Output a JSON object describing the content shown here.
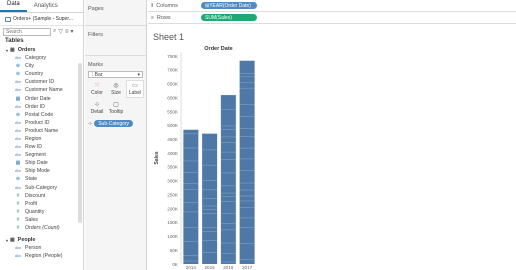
{
  "data_pane": {
    "tabs": [
      "Data",
      "Analytics"
    ],
    "datasource": "Orders+ (Sample - Super...",
    "search_placeholder": "Search",
    "tables_title": "Tables",
    "groups": [
      {
        "name": "Orders",
        "dimensions": [
          {
            "name": "Category",
            "icon": "abc"
          },
          {
            "name": "City",
            "icon": "globe"
          },
          {
            "name": "Country",
            "icon": "globe"
          },
          {
            "name": "Customer ID",
            "icon": "abc"
          },
          {
            "name": "Customer Name",
            "icon": "abc"
          },
          {
            "name": "Order Date",
            "icon": "date"
          },
          {
            "name": "Order ID",
            "icon": "abc"
          },
          {
            "name": "Postal Code",
            "icon": "globe"
          },
          {
            "name": "Product ID",
            "icon": "abc"
          },
          {
            "name": "Product Name",
            "icon": "abc"
          },
          {
            "name": "Region",
            "icon": "abc"
          },
          {
            "name": "Row ID",
            "icon": "abc"
          },
          {
            "name": "Segment",
            "icon": "abc"
          },
          {
            "name": "Ship Date",
            "icon": "date"
          },
          {
            "name": "Ship Mode",
            "icon": "abc"
          },
          {
            "name": "State",
            "icon": "globe"
          },
          {
            "name": "Sub-Category",
            "icon": "abc"
          }
        ],
        "measures": [
          {
            "name": "Discount",
            "icon": "hash"
          },
          {
            "name": "Profit",
            "icon": "hash"
          },
          {
            "name": "Quantity",
            "icon": "hash"
          },
          {
            "name": "Sales",
            "icon": "hash"
          },
          {
            "name": "Orders (Count)",
            "icon": "hash"
          }
        ]
      },
      {
        "name": "People",
        "dimensions": [
          {
            "name": "Person",
            "icon": "abc"
          },
          {
            "name": "Region (People)",
            "icon": "abc"
          }
        ],
        "measures": []
      }
    ]
  },
  "cards": {
    "pages": "Pages",
    "filters": "Filters",
    "marks": "Marks",
    "mark_type": "Bar",
    "mark_buttons": [
      "Color",
      "Size",
      "Label",
      "Detail",
      "Tooltip"
    ],
    "detail_pill": "Sub-Category"
  },
  "shelves": {
    "columns_label": "Columns",
    "columns_pill": "YEAR(Order Date)",
    "rows_label": "Rows",
    "rows_pill": "SUM(Sales)"
  },
  "view": {
    "sheet_title": "Sheet 1"
  },
  "colors": {
    "bar": "#4e79a7",
    "dimension_pill": "#4e8ac4",
    "measure_pill": "#1ea876"
  },
  "chart_data": {
    "type": "bar",
    "title": "Order Date",
    "ylabel": "Sales",
    "categories": [
      "2014",
      "2015",
      "2016",
      "2017"
    ],
    "values": [
      484000,
      470000,
      609000,
      733000
    ],
    "ylim": [
      0,
      750000
    ],
    "yticks": [
      "0K",
      "50K",
      "100K",
      "150K",
      "200K",
      "250K",
      "300K",
      "350K",
      "400K",
      "450K",
      "500K",
      "550K",
      "600K",
      "650K",
      "700K",
      "750K"
    ],
    "ytick_values": [
      0,
      50000,
      100000,
      150000,
      200000,
      250000,
      300000,
      350000,
      400000,
      450000,
      500000,
      550000,
      600000,
      650000,
      700000,
      750000
    ]
  }
}
